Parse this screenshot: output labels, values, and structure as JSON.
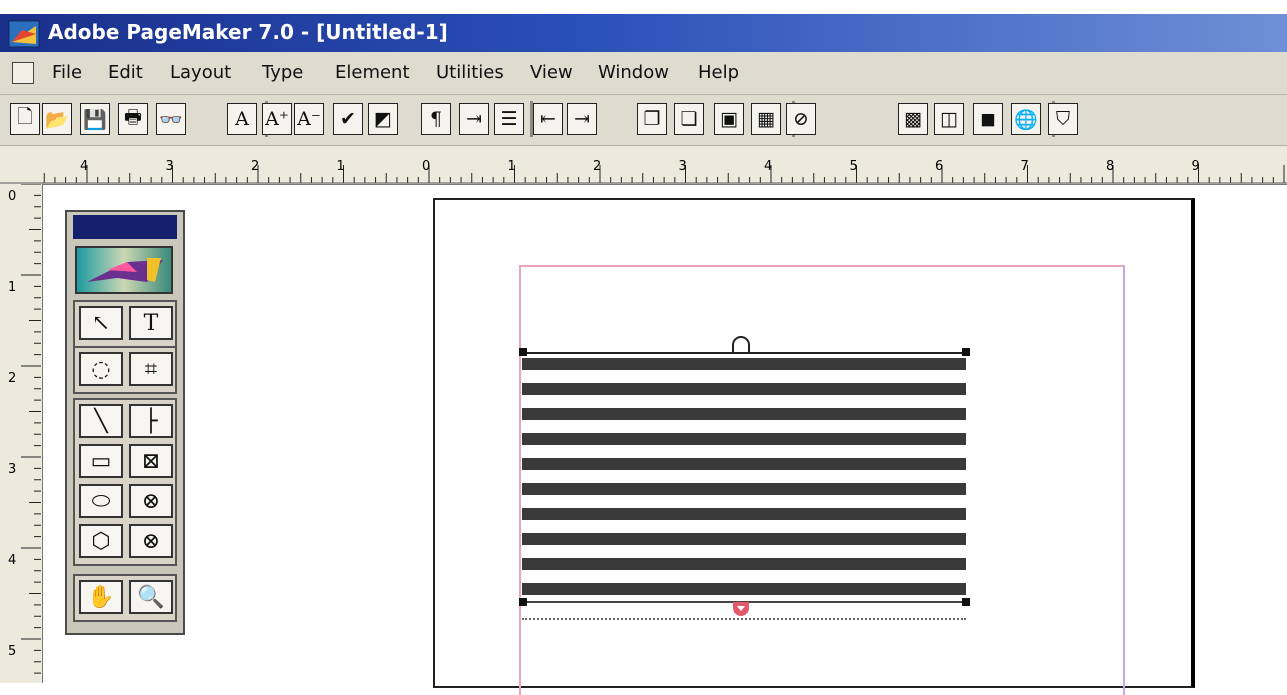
{
  "window": {
    "title": "Adobe PageMaker 7.0 - [Untitled-1]"
  },
  "menu": {
    "items": [
      "File",
      "Edit",
      "Layout",
      "Type",
      "Element",
      "Utilities",
      "View",
      "Window",
      "Help"
    ]
  },
  "toolbar": {
    "buttons": [
      {
        "name": "new-document-icon",
        "glyph": "🗋"
      },
      {
        "name": "open-folder-icon",
        "glyph": "📂"
      },
      {
        "name": "save-disk-icon",
        "glyph": "💾"
      },
      {
        "name": "print-icon",
        "glyph": "🖶"
      },
      {
        "name": "find-binoculars-icon",
        "glyph": "👓"
      },
      {
        "name": "character-format-icon",
        "glyph": "A"
      },
      {
        "name": "increase-size-icon",
        "glyph": "A⁺"
      },
      {
        "name": "decrease-size-icon",
        "glyph": "A⁻"
      },
      {
        "name": "spelling-check-icon",
        "glyph": "✔"
      },
      {
        "name": "fill-stroke-icon",
        "glyph": "◩"
      },
      {
        "name": "paragraph-icon",
        "glyph": "¶"
      },
      {
        "name": "indent-tabs-icon",
        "glyph": "⇥"
      },
      {
        "name": "bullets-icon",
        "glyph": "☰"
      },
      {
        "name": "decrease-indent-icon",
        "glyph": "⇤"
      },
      {
        "name": "increase-indent-icon",
        "glyph": "⇥"
      },
      {
        "name": "copy-icon",
        "glyph": "❐"
      },
      {
        "name": "paste-icon",
        "glyph": "❏"
      },
      {
        "name": "place-icon",
        "glyph": "▣"
      },
      {
        "name": "image-icon",
        "glyph": "▦"
      },
      {
        "name": "link-icon",
        "glyph": "⊘"
      },
      {
        "name": "export-pdf-icon",
        "glyph": "▩"
      },
      {
        "name": "distill-icon",
        "glyph": "◫"
      },
      {
        "name": "color-picture-icon",
        "glyph": "◼"
      },
      {
        "name": "globe-icon",
        "glyph": "🌐"
      },
      {
        "name": "acrobat-icon",
        "glyph": "⛉"
      }
    ]
  },
  "ruler": {
    "horizontal_labels": [
      "4",
      "3",
      "2",
      "1",
      "0",
      "1",
      "2",
      "3",
      "4",
      "5",
      "6",
      "7",
      "8",
      "9"
    ],
    "vertical_labels": [
      "0",
      "1",
      "2",
      "3",
      "4",
      "5"
    ]
  },
  "toolbox": {
    "tools": [
      {
        "name": "pointer-tool-icon",
        "glyph": "↖"
      },
      {
        "name": "text-tool-icon",
        "glyph": "T"
      },
      {
        "name": "rotate-tool-icon",
        "glyph": "◌"
      },
      {
        "name": "crop-tool-icon",
        "glyph": "⌗"
      },
      {
        "name": "line-tool-icon",
        "glyph": "╲"
      },
      {
        "name": "constrained-line-tool-icon",
        "glyph": "├"
      },
      {
        "name": "rectangle-tool-icon",
        "glyph": "▭"
      },
      {
        "name": "rectangle-frame-tool-icon",
        "glyph": "⊠"
      },
      {
        "name": "ellipse-tool-icon",
        "glyph": "⬭"
      },
      {
        "name": "ellipse-frame-tool-icon",
        "glyph": "⊗"
      },
      {
        "name": "polygon-tool-icon",
        "glyph": "⬡"
      },
      {
        "name": "polygon-frame-tool-icon",
        "glyph": "⊗"
      },
      {
        "name": "hand-tool-icon",
        "glyph": "✋"
      },
      {
        "name": "zoom-tool-icon",
        "glyph": "🔍"
      }
    ]
  },
  "colors": {
    "titlebar_start": "#1a2f8a",
    "margin_guide": "#e8a7b9",
    "text_line": "#3a3a3a",
    "windowshade_handle": "#e05a6a"
  },
  "document": {
    "text_line_count": 10
  }
}
